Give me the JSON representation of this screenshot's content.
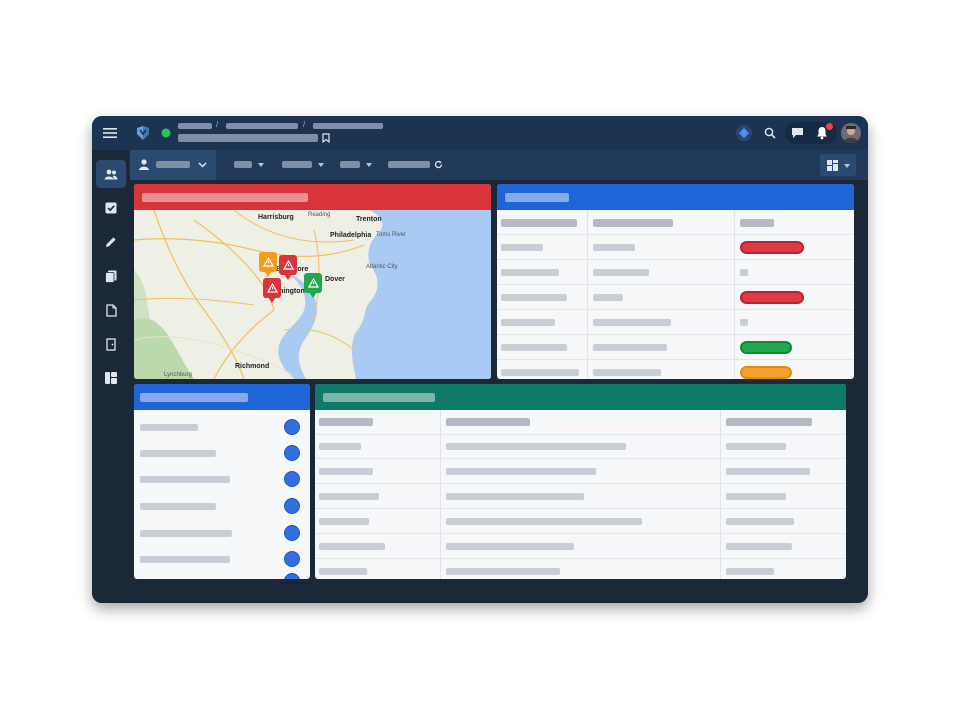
{
  "colors": {
    "red_header": "#d9333c",
    "blue_header": "#1f65d8",
    "green_header": "#0f7a68",
    "pill_red": "#dc3b45",
    "pill_green": "#20a84a",
    "pill_orange": "#f4a328",
    "circle_blue": "#2f6fe0"
  },
  "icons": {
    "menu": "hamburger-menu-icon",
    "logo": "app-logo-icon",
    "status": "status-dot-icon",
    "bookmark": "bookmark-icon",
    "diamond": "diamond-icon",
    "search": "search-icon",
    "messages": "messages-icon",
    "bell": "notification-bell-icon",
    "avatar": "user-avatar",
    "user": "user-icon",
    "layout": "layout-grid-icon"
  },
  "map": {
    "labels": {
      "harrisburg": "Harrisburg",
      "reading": "Reading",
      "trenton": "Trenton",
      "philadelphia": "Philadelphia",
      "toms_river": "Toms River",
      "atlantic_city": "Atlantic City",
      "dover": "Dover",
      "baltimore": "Baltimore",
      "washington": "Washington",
      "richmond": "Richmond",
      "lynchburg": "Lynchburg"
    }
  },
  "status_pills": [
    "red",
    "empty",
    "red",
    "empty",
    "green",
    "orange"
  ]
}
